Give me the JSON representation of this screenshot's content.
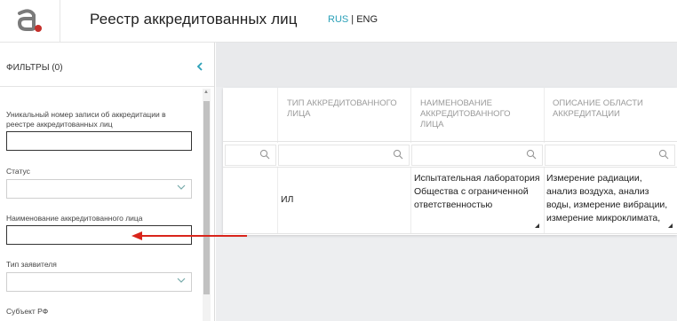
{
  "app": {
    "logo_icon": "stylized-a-logo",
    "title": "Реестр аккредитованных лиц",
    "lang_rus": "RUS",
    "lang_sep": " | ",
    "lang_eng": "ENG"
  },
  "colors": {
    "accent": "#2aa0b8",
    "brand": "#c4302b",
    "annotation_arrow": "#d9241b"
  },
  "sidebar": {
    "title": "ФИЛЬТРЫ (0)",
    "collapse_icon": "chevron-left-icon",
    "fields": {
      "accreditation_number": {
        "label": "Уникальный номер записи об аккредитации в реестре аккредитованных лиц",
        "value": ""
      },
      "status": {
        "label": "Статус",
        "value": ""
      },
      "entity_name": {
        "label": "Наименование аккредитованного лица",
        "value": ""
      },
      "applicant_type": {
        "label": "Тип заявителя",
        "value": ""
      },
      "subject": {
        "label": "Субъект РФ"
      }
    }
  },
  "table": {
    "columns": [
      "ТИП АККРЕДИТОВАННОГО ЛИЦА",
      "НАИМЕНОВАНИЕ АККРЕДИТОВАННОГО ЛИЦА",
      "ОПИСАНИЕ ОБЛАСТИ АККРЕДИТАЦИИ"
    ],
    "rows": [
      {
        "type": "ИЛ",
        "name": "Испытательная лаборатория Общества с ограниченной ответственностью",
        "scope": "Измерение радиации, анализ воздуха, анализ воды, измерение вибрации, измерение микроклимата,"
      }
    ]
  }
}
